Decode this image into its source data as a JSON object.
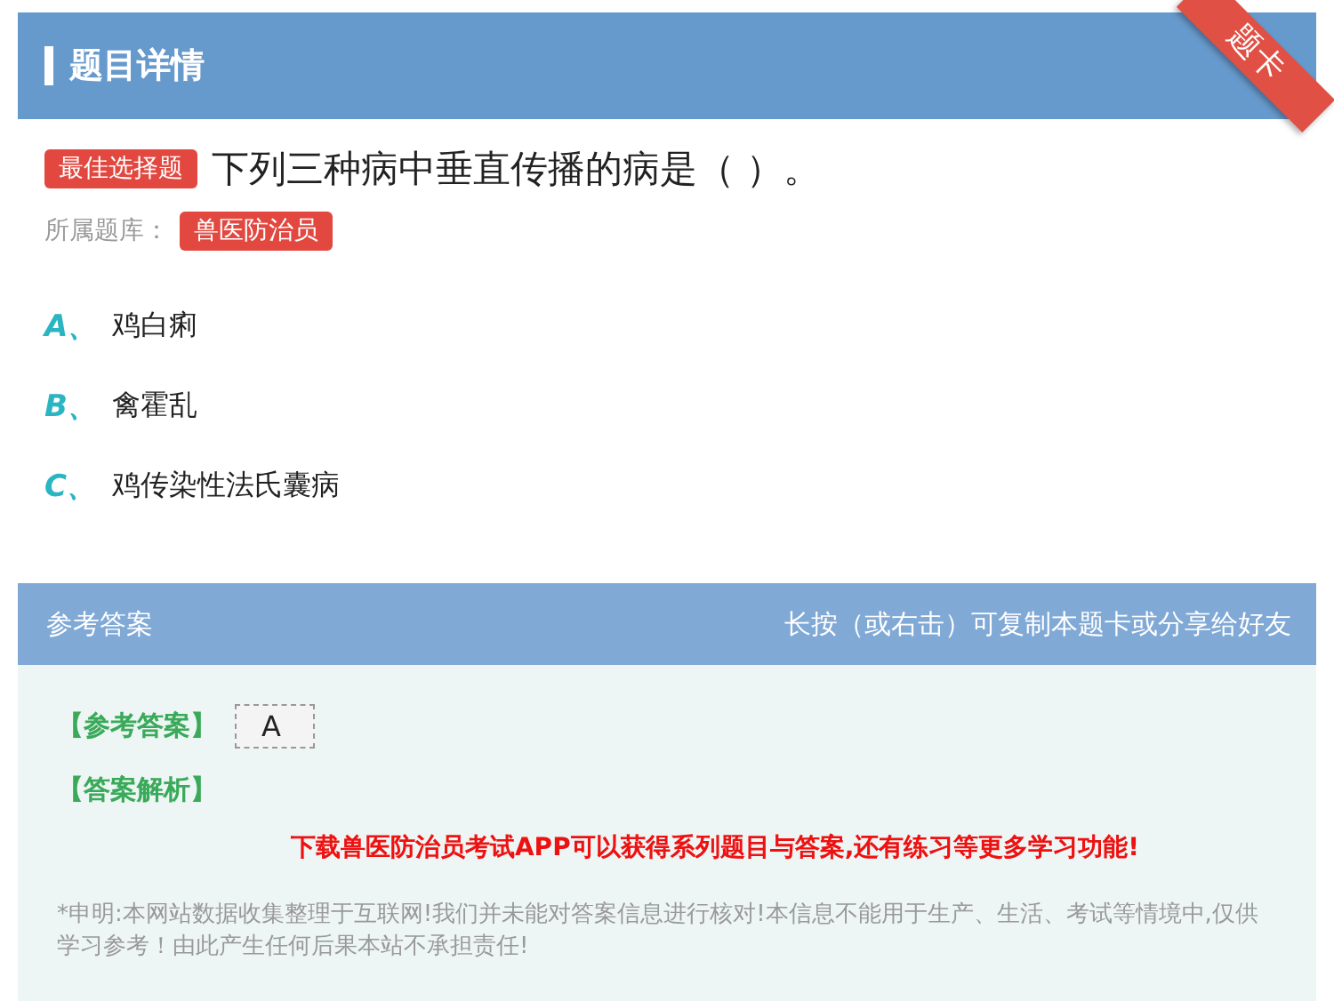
{
  "header": {
    "title": "题目详情",
    "ribbon": "题卡"
  },
  "question": {
    "type_tag": "最佳选择题",
    "text": "下列三种病中垂直传播的病是（ ）。",
    "bank_label": "所属题库：",
    "bank_tag": "兽医防治员"
  },
  "options": [
    {
      "letter": "A、",
      "text": "鸡白痢"
    },
    {
      "letter": "B、",
      "text": "禽霍乱"
    },
    {
      "letter": "C、",
      "text": "鸡传染性法氏囊病"
    }
  ],
  "answer_panel": {
    "title": "参考答案",
    "hint": "长按（或右击）可复制本题卡或分享给好友",
    "answer_label": "【参考答案】",
    "answer": "A",
    "analysis_label": "【答案解析】",
    "promo": "下载兽医防治员考试APP可以获得系列题目与答案,还有练习等更多学习功能!",
    "disclaimer": "*申明:本网站数据收集整理于互联网!我们并未能对答案信息进行核对!本信息不能用于生产、生活、考试等情境中,仅供学习参考！由此产生任何后果本站不承担责任!"
  }
}
